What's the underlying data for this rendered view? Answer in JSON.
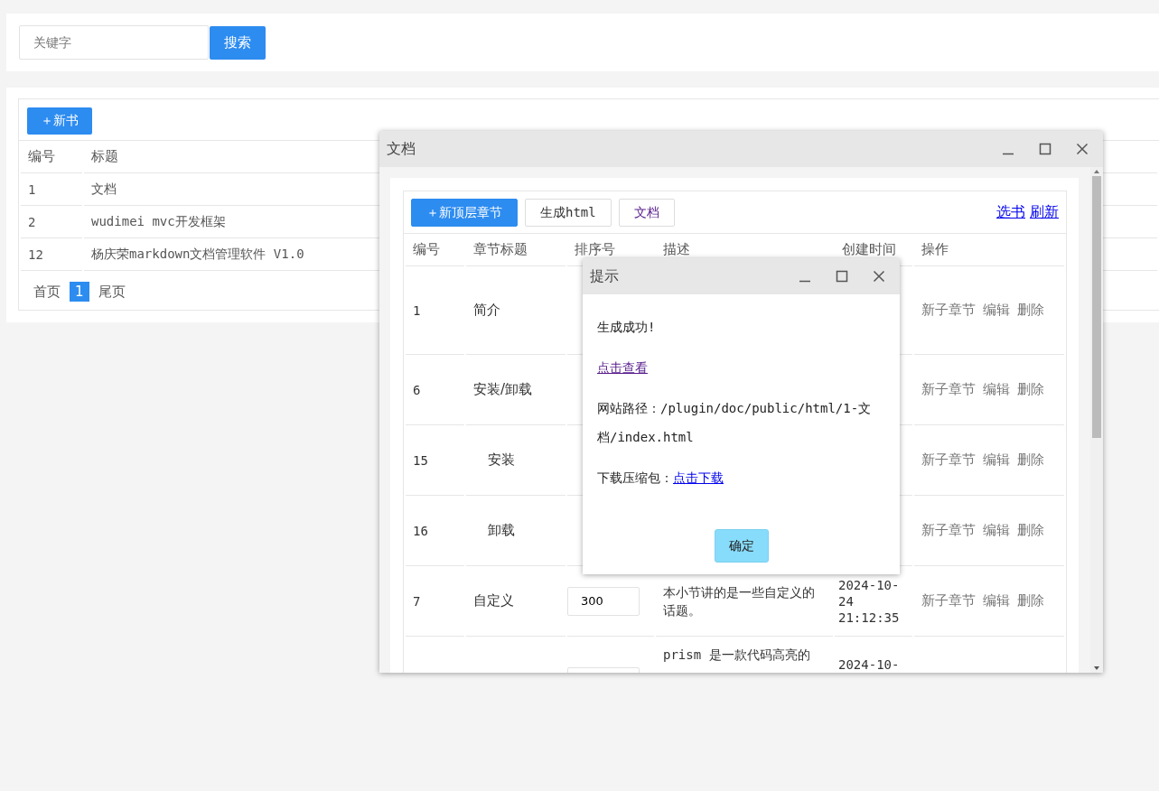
{
  "search": {
    "placeholder": "关键字",
    "button": "搜索"
  },
  "books": {
    "new_button": "＋新书",
    "columns": [
      "编号",
      "标题"
    ],
    "rows": [
      {
        "id": "1",
        "title": "文档"
      },
      {
        "id": "2",
        "title": "wudimei mvc开发框架"
      },
      {
        "id": "12",
        "title": "杨庆荣markdown文档管理软件 V1.0"
      }
    ],
    "pagination": {
      "first": "首页",
      "pages": [
        {
          "label": "1",
          "selected": true
        }
      ],
      "last": "尾页"
    }
  },
  "doc_window": {
    "title": "文档",
    "buttons": [
      {
        "label": "＋新顶层章节",
        "kind": "primary"
      },
      {
        "label": "生成html",
        "kind": "default"
      },
      {
        "label": "文档",
        "kind": "visited"
      }
    ],
    "links": [
      "选书",
      "刷新"
    ],
    "columns": [
      "编号",
      "章节标题",
      "排序号",
      "描述",
      "创建时间",
      "操作"
    ],
    "rows": [
      {
        "id": "1",
        "title": "简介",
        "actions": [
          "新子章节",
          "编辑",
          "删除"
        ]
      },
      {
        "id": "6",
        "title": "安装/卸载",
        "actions": [
          "新子章节",
          "编辑",
          "删除"
        ],
        "children": [
          {
            "id": "15",
            "title": "安装",
            "actions": [
              "新子章节",
              "编辑",
              "删除"
            ]
          },
          {
            "id": "16",
            "title": "卸载",
            "actions": [
              "新子章节",
              "编辑",
              "删除"
            ]
          }
        ]
      },
      {
        "id": "7",
        "title": "自定义",
        "sort": "300",
        "description": "本小节讲的是一些自定义的话题。",
        "created": "2024-10-24 21:12:35",
        "actions": [
          "新子章节",
          "编辑",
          "删除"
        ]
      },
      {
        "sort_field": true,
        "description": "prism 是一款代码高亮的",
        "created": "2024-10-"
      }
    ]
  },
  "dialog": {
    "title": "提示",
    "message": "生成成功!",
    "view_link": "点击查看",
    "path_label": "网站路径：",
    "path": "/plugin/doc/public/html/1-文档/index.html",
    "download_label": "下载压缩包：",
    "download_link": "点击下载",
    "ok": "确定"
  }
}
